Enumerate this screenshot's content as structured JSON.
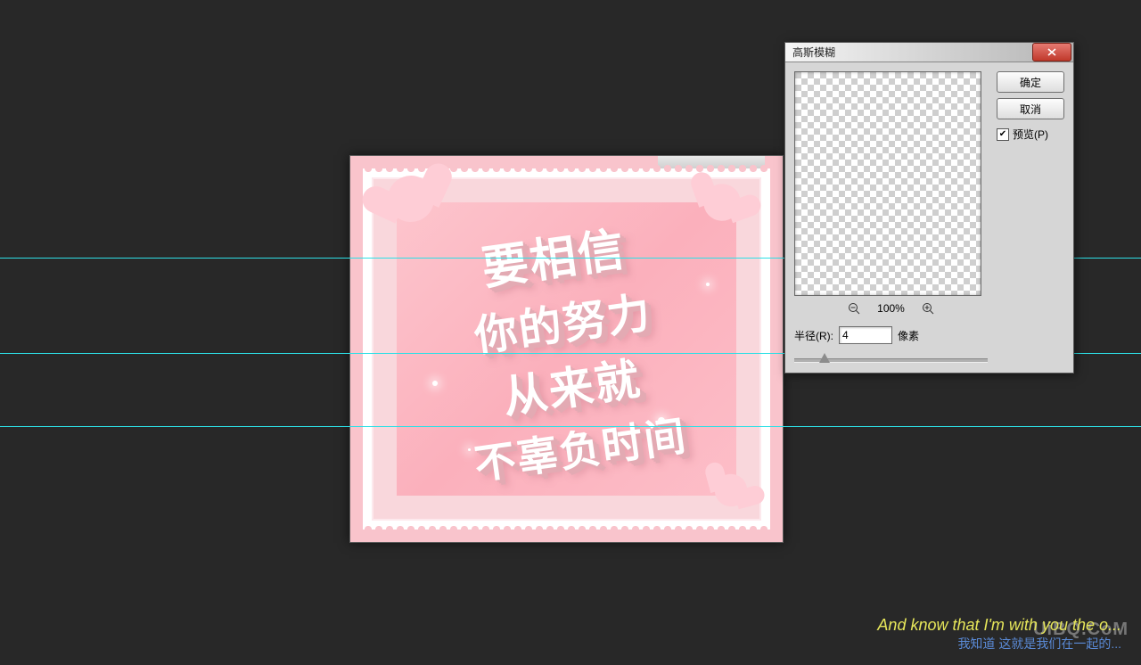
{
  "guides": [
    289,
    396,
    478
  ],
  "dialog": {
    "title": "高斯模糊",
    "ok": "确定",
    "cancel": "取消",
    "preview_label": "预览(P)",
    "preview_checked": true,
    "zoom_pct": "100%",
    "radius_label": "半径(R):",
    "radius_value": "4",
    "radius_unit": "像素"
  },
  "artwork": {
    "line1": "要相信",
    "line2": "你的努力",
    "line3": "从来就",
    "line4": "不辜负时间"
  },
  "watermark": {
    "en": "And know that I'm with you the o...",
    "zh": "我知道 这就是我们在一起的...",
    "logo": "UiBQ.CoM"
  }
}
